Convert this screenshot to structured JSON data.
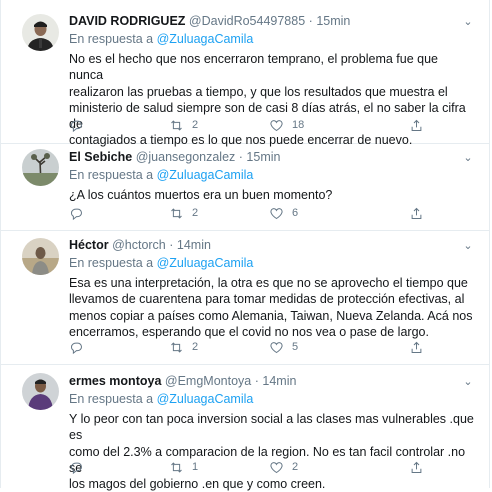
{
  "tweets": [
    {
      "name": "DAVID RODRIGUEZ",
      "handle": "@DavidRo54497885",
      "sep": "·",
      "time": "15min",
      "reply_prefix": "En respuesta a",
      "reply_mention": "@ZuluagaCamila",
      "text": "No es el hecho que nos encerraron temprano, el problema fue que nunca\nrealizaron las pruebas a tiempo, y que los resultados que muestra el\nministerio de salud siempre son de casi 8 días atrás, el no saber la cifra de\ncontagiados a tiempo es lo que nos puede encerrar de nuevo.",
      "replies": "",
      "retweets": "2",
      "likes": "18"
    },
    {
      "name": "El Sebiche",
      "handle": "@juansegonzalez",
      "sep": "·",
      "time": "15min",
      "reply_prefix": "En respuesta a",
      "reply_mention": "@ZuluagaCamila",
      "text": "¿A los cuántos muertos era un buen momento?",
      "replies": "",
      "retweets": "2",
      "likes": "6"
    },
    {
      "name": "Héctor",
      "handle": "@hctorch",
      "sep": "·",
      "time": "14min",
      "reply_prefix": "En respuesta a",
      "reply_mention": "@ZuluagaCamila",
      "text": "Esa es una interpretación, la otra es que no se aprovecho el tiempo que\nllevamos de cuarentena para tomar medidas de protección efectivas, al\nmenos copiar a países como Alemania, Taiwan, Nueva Zelanda. Acá nos\nencerramos, esperando que el covid no nos vea o pase de largo.",
      "replies": "",
      "retweets": "2",
      "likes": "5"
    },
    {
      "name": "ermes montoya",
      "handle": "@EmgMontoya",
      "sep": "·",
      "time": "14min",
      "reply_prefix": "En respuesta a",
      "reply_mention": "@ZuluagaCamila",
      "text": "Y lo peor con tan poca inversion social a las clases mas vulnerables .que es\ncomo del 2.3% a comparacion de la region. No es tan facil controlar .no se\nlos magos del gobierno .en que y como creen.",
      "replies": "",
      "retweets": "1",
      "likes": "2"
    }
  ],
  "icons": {
    "caret": "chevron-down-icon",
    "reply": "reply-icon",
    "retweet": "retweet-icon",
    "like": "heart-icon",
    "share": "share-icon"
  },
  "colors": {
    "link": "#1da1f2",
    "secondary_text": "#657786",
    "primary_text": "#14171a",
    "divider": "#e6ecf0"
  }
}
